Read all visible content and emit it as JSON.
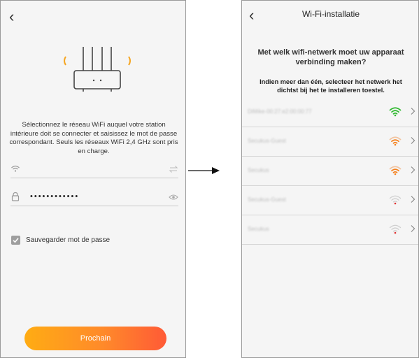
{
  "left_screen": {
    "back_icon": "chevron-left-icon",
    "router_icon": "router-icon",
    "description": "Sélectionnez le réseau WiFi auquel votre station intérieure doit se connecter et saisissez le mot de passe correspondant. Seuls les réseaux WiFi 2,4 GHz sont pris en charge.",
    "wifi_field": {
      "value": "",
      "placeholder": ""
    },
    "password_field": {
      "value": "••••••••••••"
    },
    "save_password": {
      "label": "Sauvegarder mot de passe",
      "checked": true
    },
    "next_button": "Prochain"
  },
  "right_screen": {
    "title": "Wi-Fi-installatie",
    "heading": "Met welk wifi-netwerk moet uw apparaat verbinding maken?",
    "subheading": "Indien meer dan één, selecteer het netwerk het dichtst bij het te installeren toestel.",
    "networks": [
      {
        "name": "DiMike-00:27:e2:00:00:77",
        "signal_color": "#2fb92f",
        "signal": "full"
      },
      {
        "name": "Secukus-Guest",
        "signal_color": "#f5821f",
        "signal": "medium"
      },
      {
        "name": "Secukus",
        "signal_color": "#f5821f",
        "signal": "medium"
      },
      {
        "name": "Secukus-Guest",
        "signal_color": "#e03030",
        "signal": "weak"
      },
      {
        "name": "Secukus",
        "signal_color": "#e03030",
        "signal": "weak"
      }
    ]
  },
  "colors": {
    "button_gradient_start": "#ffac13",
    "button_gradient_end": "#ff5a36",
    "router_accent": "#f5a623"
  }
}
